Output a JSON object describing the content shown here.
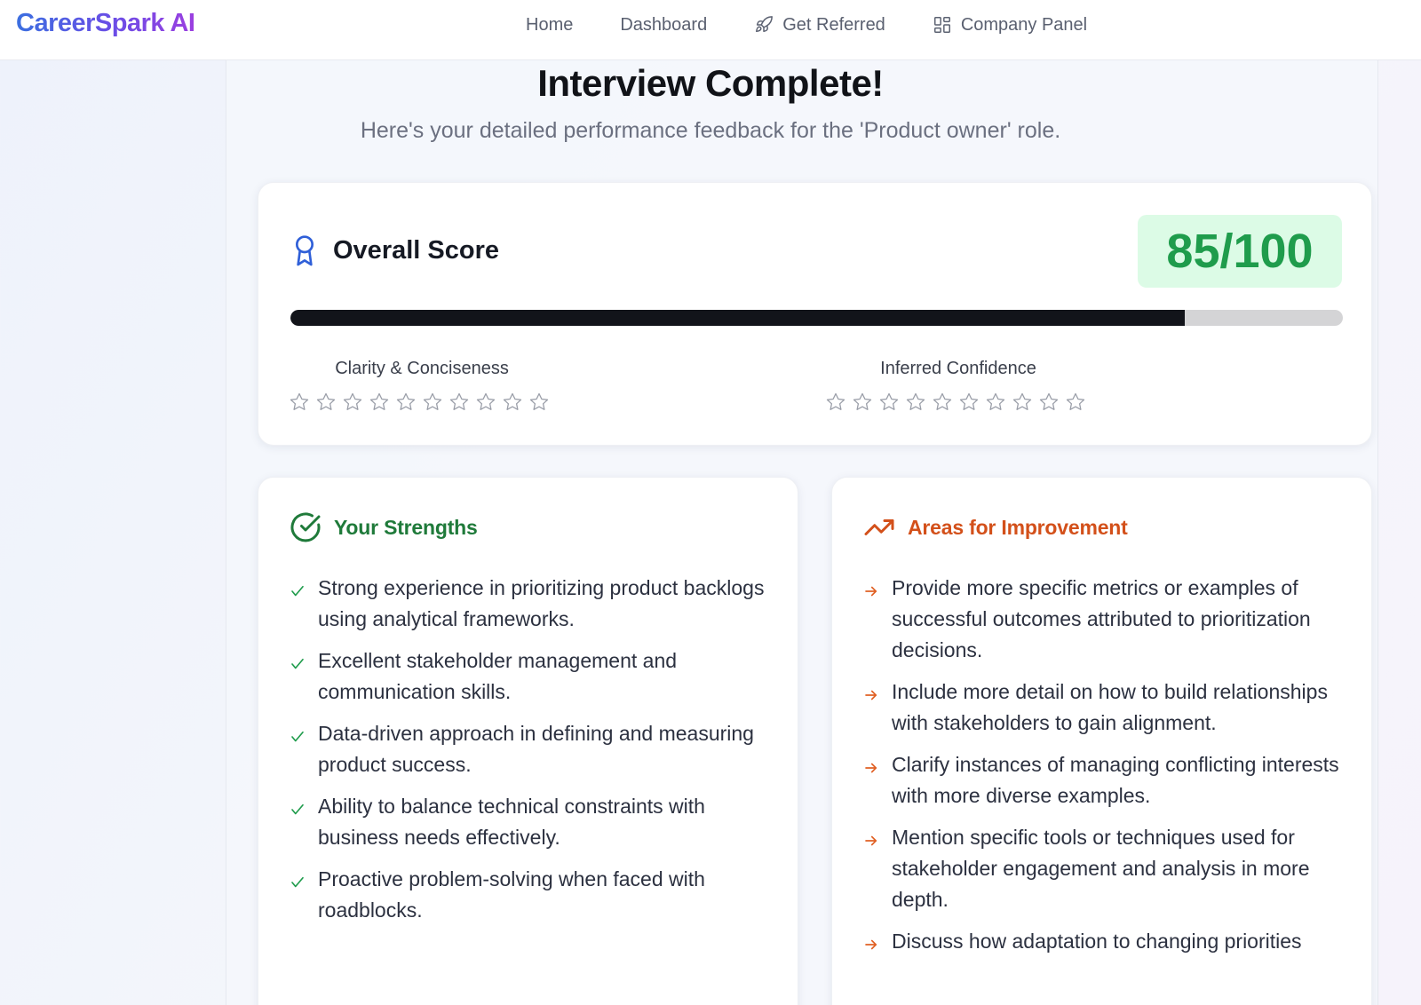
{
  "nav": {
    "brand": "CareerSpark AI",
    "links": [
      {
        "label": "Home",
        "icon": ""
      },
      {
        "label": "Dashboard",
        "icon": ""
      },
      {
        "label": "Get Referred",
        "icon": "rocket-icon"
      },
      {
        "label": "Company Panel",
        "icon": "grid-icon"
      }
    ]
  },
  "header": {
    "title": "Interview Complete!",
    "subtitle": "Here's your detailed performance feedback for the 'Product owner' role."
  },
  "score": {
    "title": "Overall Score",
    "value": "85/100",
    "progress_fraction": 0.85,
    "metrics": [
      {
        "label": "Clarity & Conciseness",
        "stars_total": 10,
        "stars_filled": 0
      },
      {
        "label": "Inferred Confidence",
        "stars_total": 10,
        "stars_filled": 0
      }
    ]
  },
  "strengths": {
    "title": "Your Strengths",
    "items": [
      "Strong experience in prioritizing product backlogs using analytical frameworks.",
      "Excellent stakeholder management and communication skills.",
      "Data-driven approach in defining and measuring product success.",
      "Ability to balance technical constraints with business needs effectively.",
      "Proactive problem-solving when faced with roadblocks."
    ]
  },
  "improvements": {
    "title": "Areas for Improvement",
    "items": [
      "Provide more specific metrics or examples of successful outcomes attributed to prioritization decisions.",
      "Include more detail on how to build relationships with stakeholders to gain alignment.",
      "Clarify instances of managing conflicting interests with more diverse examples.",
      "Mention specific tools or techniques used for stakeholder engagement and analysis in more depth.",
      "Discuss how adaptation to changing priorities"
    ]
  },
  "colors": {
    "brand_start": "#3b6fe0",
    "brand_end": "#9b3fe0",
    "score_green": "#1f9c4c",
    "score_badge_bg": "#dcfbe6",
    "strength_green": "#1f7a3a",
    "improve_orange": "#d3501a",
    "award_blue": "#2f5fd8"
  }
}
